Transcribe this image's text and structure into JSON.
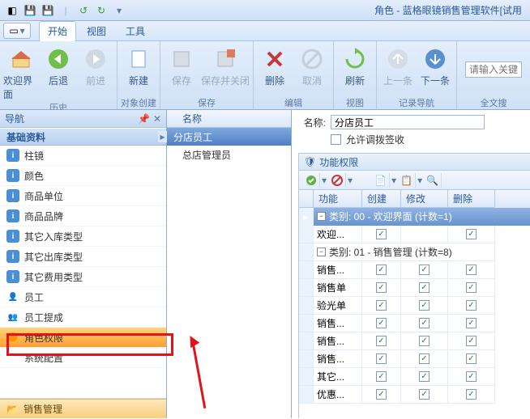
{
  "title": "角色 - 蓝格眼镜销售管理软件[试用",
  "menutabs": {
    "start": "开始",
    "view": "视图",
    "tool": "工具"
  },
  "ribbon": {
    "welcome": "欢迎界面",
    "back": "后退",
    "forward": "前进",
    "history": "历史",
    "new": "新建",
    "objcreate": "对象创建",
    "save": "保存",
    "saveclose": "保存并关闭",
    "savegrp": "保存",
    "delete": "删除",
    "cancel": "取消",
    "edit": "编辑",
    "refresh": "刷新",
    "viewgrp": "视图",
    "prev": "上一条",
    "next": "下一条",
    "recordnav": "记录导航",
    "searchPlaceholder": "请输入关键字",
    "fulltext": "全文搜"
  },
  "nav": {
    "title": "导航",
    "category": "基础资料",
    "items": [
      "柱镜",
      "颜色",
      "商品单位",
      "商品品牌",
      "其它入库类型",
      "其它出库类型",
      "其它费用类型",
      "员工",
      "员工提成",
      "角色权限",
      "系统配置"
    ],
    "bottomCat": "销售管理"
  },
  "list": {
    "col": "名称",
    "items": [
      "分店员工",
      "总店管理员"
    ]
  },
  "detail": {
    "nameLabel": "名称:",
    "nameValue": "分店员工",
    "allowCheckLabel": "允许调拨签收",
    "permHeader": "功能权限",
    "gridCols": {
      "c1": "功能",
      "c2": "创建",
      "c3": "修改",
      "c4": "删除"
    },
    "group0": "类别: 00 - 欢迎界面 (计数=1)",
    "group1": "类别: 01 - 销售管理 (计数=8)",
    "rows": [
      "欢迎...",
      "销售...",
      "销售单",
      "验光单",
      "销售...",
      "销售...",
      "销售...",
      "其它...",
      "优惠..."
    ]
  }
}
